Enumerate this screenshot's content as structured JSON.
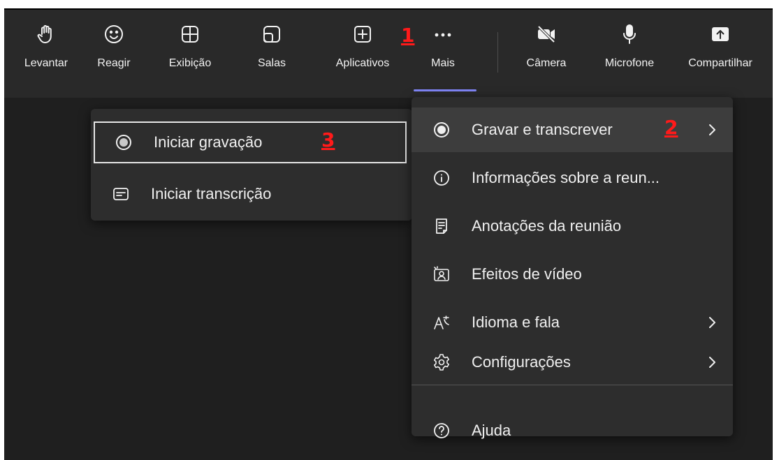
{
  "toolbar": {
    "buttons": [
      {
        "label": "Levantar",
        "icon": "raise-hand-icon"
      },
      {
        "label": "Reagir",
        "icon": "smiley-icon"
      },
      {
        "label": "Exibição",
        "icon": "grid-view-icon"
      },
      {
        "label": "Salas",
        "icon": "rooms-icon"
      },
      {
        "label": "Aplicativos",
        "icon": "add-app-icon"
      },
      {
        "label": "Mais",
        "icon": "more-dots-icon"
      },
      {
        "label": "Câmera",
        "icon": "camera-off-icon"
      },
      {
        "label": "Microfone",
        "icon": "microphone-icon"
      },
      {
        "label": "Compartilhar",
        "icon": "share-screen-icon"
      }
    ],
    "active_button": "Mais"
  },
  "markers": {
    "m1": "1",
    "m2": "2",
    "m3": "3"
  },
  "submenu": {
    "items": [
      {
        "label": "Iniciar gravação",
        "icon": "record-icon"
      },
      {
        "label": "Iniciar transcrição",
        "icon": "transcript-icon"
      }
    ]
  },
  "mainmenu": {
    "items": [
      {
        "label": "Gravar e transcrever",
        "icon": "record-icon",
        "has_submenu": true
      },
      {
        "label": "Informações sobre a reun...",
        "icon": "info-icon",
        "has_submenu": false
      },
      {
        "label": "Anotações da reunião",
        "icon": "notes-icon",
        "has_submenu": false
      },
      {
        "label": "Efeitos de vídeo",
        "icon": "video-effects-icon",
        "has_submenu": false
      },
      {
        "label": "Idioma e fala",
        "icon": "language-icon",
        "has_submenu": true
      },
      {
        "label": "Configurações",
        "icon": "gear-icon",
        "has_submenu": true
      },
      {
        "label": "Ajuda",
        "icon": "help-icon",
        "has_submenu": false
      }
    ]
  },
  "colors": {
    "background": "#1f1f1f",
    "toolbar": "#292929",
    "menu": "#2d2d2d",
    "accent": "#7f85f5",
    "marker": "#ff1a1a"
  }
}
